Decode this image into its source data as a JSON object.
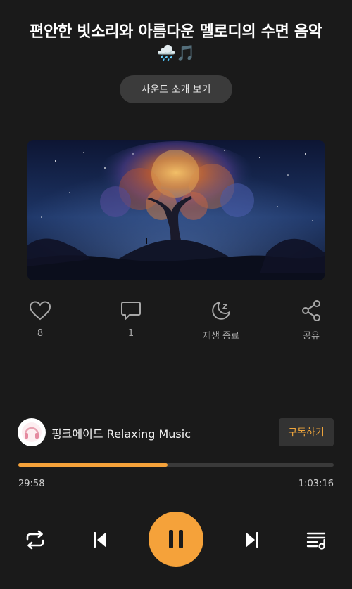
{
  "track": {
    "title": "편안한 빗소리와 아름다운 멜로디의 수면 음악",
    "title_emoji": "🌧️🎵"
  },
  "intro_button": {
    "label": "사운드 소개 보기"
  },
  "artwork": {
    "description_icon": "glowing-tree-night-artwork"
  },
  "actions": {
    "like": {
      "icon": "heart-icon",
      "label": "8"
    },
    "comment": {
      "icon": "comment-icon",
      "label": "1"
    },
    "sleep_timer": {
      "icon": "moon-sleep-icon",
      "label": "재생 종료"
    },
    "share": {
      "icon": "share-icon",
      "label": "공유"
    }
  },
  "channel": {
    "name": "핑크에이드 Relaxing Music",
    "subscribe_label": "구독하기"
  },
  "playback": {
    "current_time": "29:58",
    "total_time": "1:03:16",
    "progress": 0.474
  },
  "controls": {
    "repeat": "repeat-icon",
    "previous": "skip-previous-icon",
    "play_pause": "pause-icon",
    "next": "skip-next-icon",
    "playlist": "playlist-icon"
  },
  "colors": {
    "accent": "#f5a23a",
    "background": "#1a1a1a",
    "button_bg": "#3b3b3b"
  }
}
